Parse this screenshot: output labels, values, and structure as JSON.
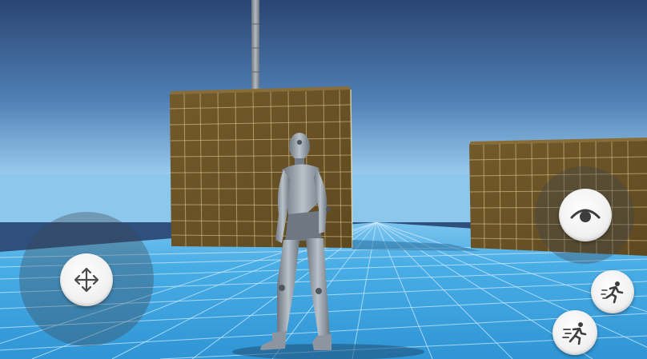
{
  "scene": {
    "sky_top_color": "#2d4a78",
    "sky_horizon_color": "#8fc3ea",
    "floor_color": "#3fa6e0",
    "grid_line_color": "#bfe6ff",
    "crate_color": "#6e5528",
    "crate_grid_color": "#e8d49a",
    "pole_color": "#8a9098",
    "character_color": "#9aa3ad"
  },
  "controls": {
    "move_joystick": {
      "icon": "move-arrows-icon"
    },
    "look_joystick": {
      "icon": "eye-icon"
    },
    "sprint_button": {
      "icon": "sprint-icon"
    },
    "run_button": {
      "icon": "run-icon"
    }
  }
}
